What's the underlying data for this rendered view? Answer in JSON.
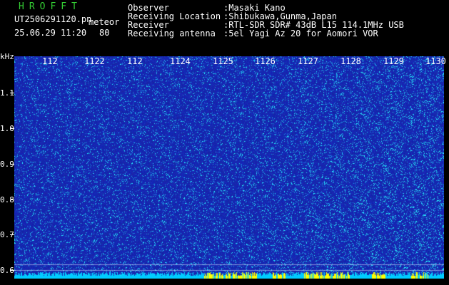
{
  "header": {
    "brand": "HROFFT",
    "filename": "UT2506291120.pn",
    "filename_suffix": "meteor",
    "datetime": "25.06.29 11:20",
    "count": "80"
  },
  "info": {
    "observer_label": "Observer",
    "observer_value": ":Masaki Kano",
    "location_label": "Receiving Location",
    "location_value": ":Shibukawa,Gunma,Japan",
    "receiver_label": "Receiver",
    "receiver_value": ":RTL-SDR SDR# 43dB L15 114.1MHz USB",
    "antenna_label": "Receiving antenna",
    "antenna_value": ":5el Yagi Az 20 for Aomori VOR"
  },
  "axis": {
    "y_unit": "kHz",
    "y_ticks": [
      "1.1",
      "1.0",
      "0.9",
      "0.8",
      "0.7",
      "0.6"
    ],
    "x_ticks": [
      "112",
      "1122",
      "112",
      "1124",
      "1125",
      "1126",
      "1127",
      "1128",
      "1129",
      "1130"
    ]
  },
  "colors": {
    "background": "#000000",
    "spectrum_low": "#1a2ab0",
    "spectrum_high": "#00ffff",
    "brand": "#33cc33",
    "bottom_strip": "#00ccff",
    "bottom_strip_alt": "#ffff00"
  }
}
